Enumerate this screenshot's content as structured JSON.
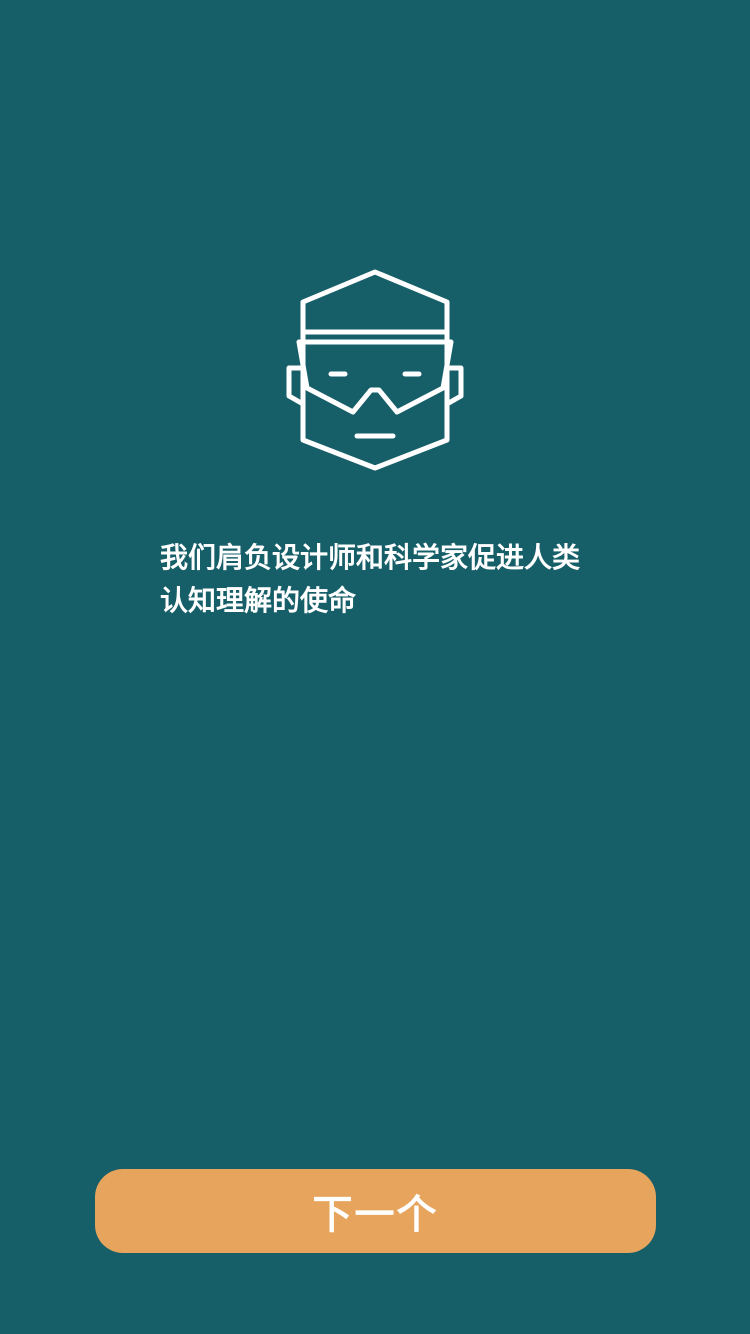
{
  "onboarding": {
    "illustration_icon": "robot-face-with-visor-icon",
    "mission_text": "我们肩负设计师和科学家促进人类认知理解的使命"
  },
  "footer": {
    "next_label": "下一个"
  },
  "colors": {
    "background": "#165f69",
    "button": "#e6a45d",
    "text": "#ffffff"
  }
}
